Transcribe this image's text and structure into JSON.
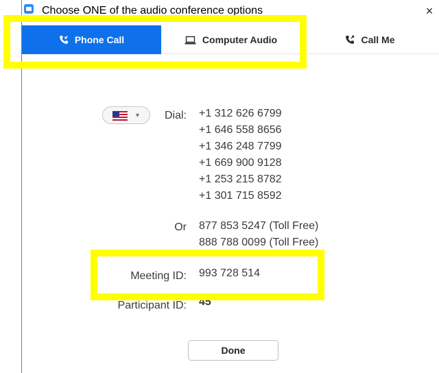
{
  "window": {
    "title": "Choose ONE of the audio conference options",
    "close_glyph": "×"
  },
  "tabs": [
    {
      "label": "Phone Call",
      "icon": "phone-call-icon",
      "active": true
    },
    {
      "label": "Computer Audio",
      "icon": "laptop-icon",
      "active": false
    },
    {
      "label": "Call Me",
      "icon": "phone-outgoing-icon",
      "active": false
    }
  ],
  "phone_call": {
    "country_selector": {
      "selected": "United States",
      "icon": "us-flag-icon"
    },
    "dial_label": "Dial:",
    "dial_numbers": [
      "+1 312 626 6799",
      "+1 646 558 8656",
      "+1 346 248 7799",
      "+1 669 900 9128",
      "+1 253 215 8782",
      "+1 301 715 8592"
    ],
    "or_label": "Or",
    "toll_free_numbers": [
      "877 853 5247 (Toll Free)",
      "888 788 0099 (Toll Free)"
    ],
    "meeting_id_label": "Meeting ID:",
    "meeting_id": "993 728 514",
    "participant_id_label": "Participant ID:",
    "participant_id": "45",
    "done_label": "Done"
  },
  "colors": {
    "active_tab": "#0e71eb",
    "highlight": "#ffff00",
    "text": "#3a3a3a"
  }
}
